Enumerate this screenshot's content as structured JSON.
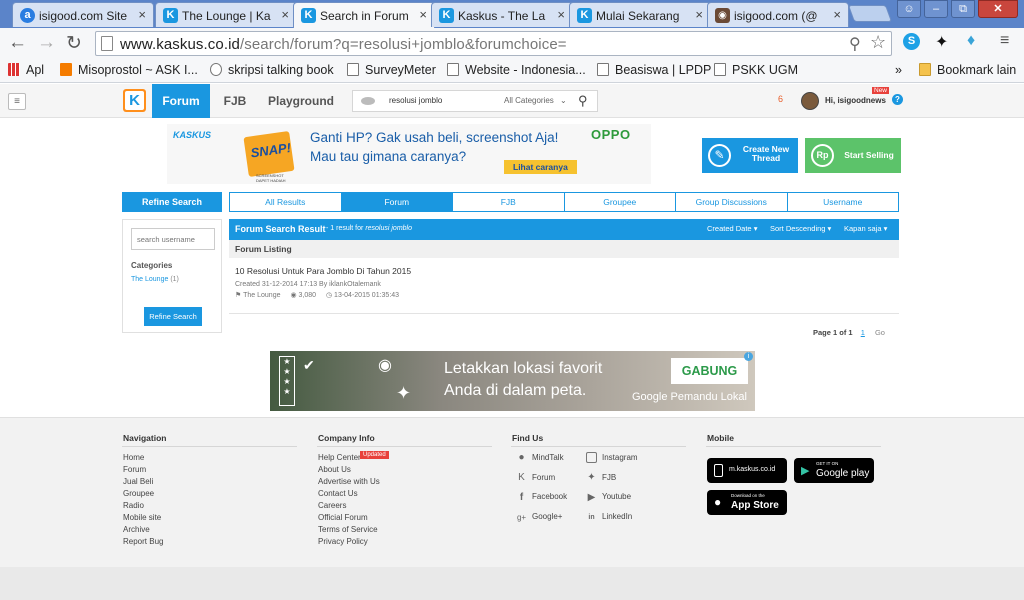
{
  "browser": {
    "tabs": [
      {
        "title": "isigood.com Site",
        "color": "#2a7de1",
        "glyph": "a"
      },
      {
        "title": "The Lounge | Ka",
        "color": "#1a97e0",
        "glyph": "K"
      },
      {
        "title": "Search in Forum",
        "color": "#1a97e0",
        "glyph": "K"
      },
      {
        "title": "Kaskus - The La",
        "color": "#1a97e0",
        "glyph": "K"
      },
      {
        "title": "Mulai Sekarang",
        "color": "#1a97e0",
        "glyph": "K"
      },
      {
        "title": "isigood.com (@",
        "color": "#6b4a36",
        "glyph": "◉"
      }
    ],
    "url_domain": "www.kaskus.co.id",
    "url_path": "/search/forum?q=resolusi+jomblo&forumchoice=",
    "bookmarks": [
      {
        "label": "Apl"
      },
      {
        "label": "Misoprostol ~ ASK I..."
      },
      {
        "label": "skripsi talking book"
      },
      {
        "label": "SurveyMeter"
      },
      {
        "label": "Website - Indonesia..."
      },
      {
        "label": "Beasiswa | LPDP"
      },
      {
        "label": "PSKK UGM"
      }
    ],
    "overflow": "»",
    "other_bookmarks": "Bookmark lain"
  },
  "nav": {
    "tabs": [
      "Forum",
      "FJB",
      "Playground"
    ],
    "search_value": "resolusi jomblo",
    "category": "All Categories",
    "notif_count": "6",
    "greeting": "Hi, isigoodnews",
    "new_badge": "New",
    "help": "?"
  },
  "banner": {
    "brand_left": "KASKUS",
    "snap": "SNAP!",
    "headline": "Ganti HP? Gak usah beli, screenshot Aja!",
    "sub": "Mau tau gimana caranya?",
    "cta": "Lihat caranya",
    "brand_right": "OPPO",
    "small": "SCREENSHOT DAPET HADIAH"
  },
  "actions": {
    "create_thread": "Create New Thread",
    "start_selling": "Start Selling"
  },
  "sidebar": {
    "title": "Refine Search",
    "username_placeholder": "search username",
    "categories_label": "Categories",
    "category_item": "The Lounge",
    "category_count": "(1)",
    "button": "Refine Search"
  },
  "result_tabs": [
    "All Results",
    "Forum",
    "FJB",
    "Groupee",
    "Group Discussions",
    "Username"
  ],
  "results": {
    "title": "Forum Search Result",
    "summary_prefix": "- 1 result for",
    "query": "resolusi jomblo",
    "sorts": [
      "Created Date",
      "Sort Descending",
      "Kapan saja"
    ],
    "listing_label": "Forum Listing",
    "items": [
      {
        "title": "10 Resolusi Untuk Para Jomblo Di Tahun 2015",
        "created": "Created 31-12-2014 17:13 By iklankOtalemank",
        "forum": "The Lounge",
        "views": "3,080",
        "last": "13-04-2015 01:35:43"
      }
    ],
    "page_label": "Page 1 of 1",
    "page_current": "1",
    "go": "Go"
  },
  "ad": {
    "line1": "Letakkan lokasi favorit",
    "line2": "Anda di dalam peta.",
    "cta": "GABUNG",
    "brand": "Google Pemandu Lokal"
  },
  "footer": {
    "navigation": {
      "title": "Navigation",
      "links": [
        "Home",
        "Forum",
        "Jual Beli",
        "Groupee",
        "Radio",
        "Mobile site",
        "Archive",
        "Report Bug"
      ]
    },
    "company": {
      "title": "Company Info",
      "links": [
        "Help Center",
        "About Us",
        "Advertise with Us",
        "Contact Us",
        "Careers",
        "Official Forum",
        "Terms of Service",
        "Privacy Policy"
      ],
      "badge": "Updated"
    },
    "findus": {
      "title": "Find Us",
      "left": [
        "MindTalk",
        "Forum",
        "Facebook",
        "Google+"
      ],
      "right": [
        "Instagram",
        "FJB",
        "Youtube",
        "LinkedIn"
      ]
    },
    "mobile": {
      "title": "Mobile",
      "mkaskus": "m.kaskus.co.id",
      "gp_small": "GET IT ON",
      "gp_big": "Google play",
      "as_small": "Download on the",
      "as_big": "App Store"
    }
  }
}
